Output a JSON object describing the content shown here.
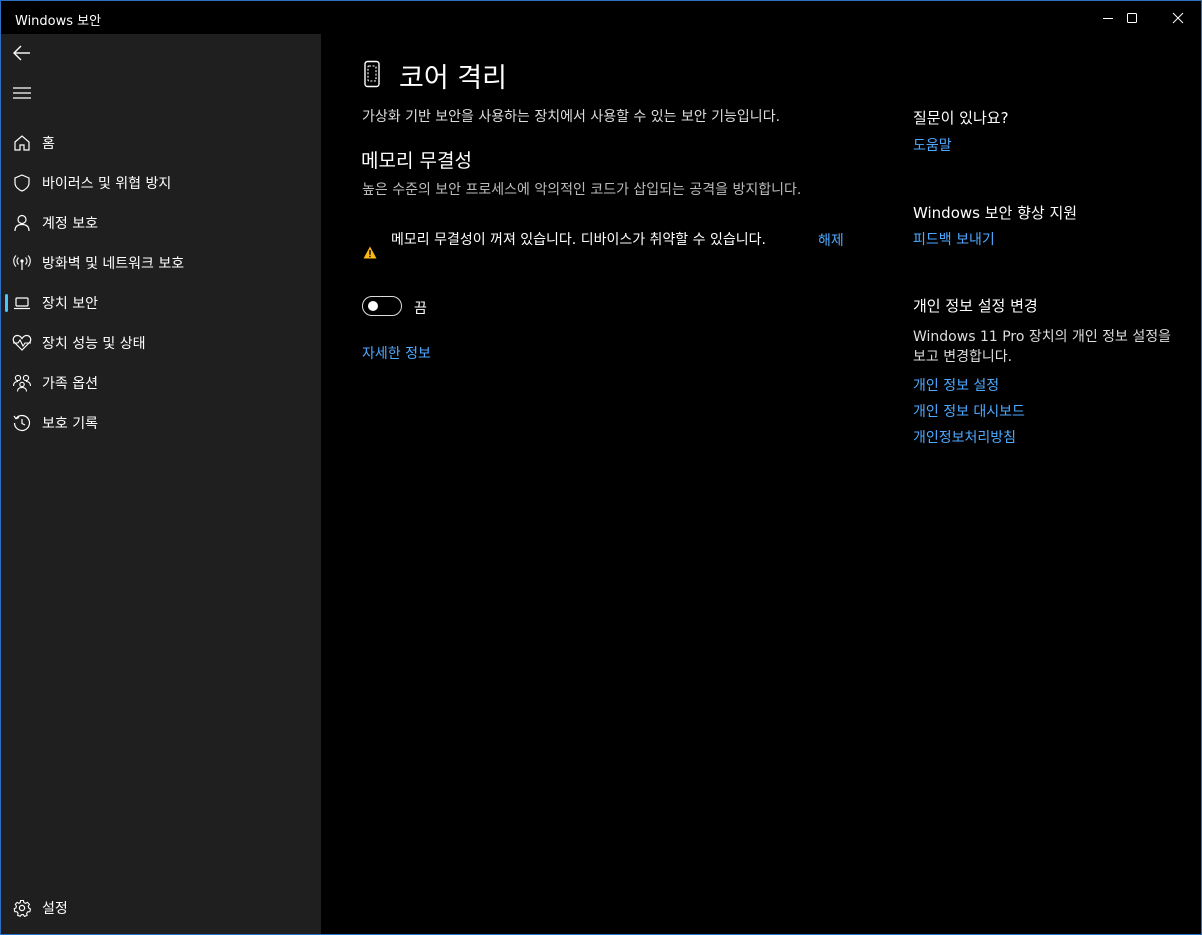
{
  "window": {
    "title": "Windows 보안",
    "minimize_icon": "minimize-icon",
    "maximize_icon": "maximize-icon",
    "close_icon": "close-icon"
  },
  "sidebar": {
    "back_icon": "back-arrow-icon",
    "menu_icon": "hamburger-menu-icon",
    "accent_color": "#4cc2ff",
    "items": [
      {
        "label": "홈",
        "icon": "home-icon"
      },
      {
        "label": "바이러스 및 위협 방지",
        "icon": "shield-icon"
      },
      {
        "label": "계정 보호",
        "icon": "person-icon"
      },
      {
        "label": "방화벽 및 네트워크 보호",
        "icon": "antenna-icon"
      },
      {
        "label": "장치 보안",
        "icon": "laptop-icon",
        "selected": true
      },
      {
        "label": "장치 성능 및 상태",
        "icon": "heart-pulse-icon"
      },
      {
        "label": "가족 옵션",
        "icon": "family-icon"
      },
      {
        "label": "보호 기록",
        "icon": "history-icon"
      }
    ],
    "settings": {
      "label": "설정",
      "icon": "gear-icon"
    }
  },
  "main": {
    "title": "코어 격리",
    "title_icon": "core-isolation-icon",
    "description": "가상화 기반 보안을 사용하는 장치에서 사용할 수 있는 보안 기능입니다.",
    "section": {
      "title": "메모리 무결성",
      "description": "높은 수준의 보안 프로세스에 악의적인 코드가 삽입되는 공격을 방지합니다.",
      "warning": {
        "icon": "warning-icon",
        "color": "#fcb814",
        "text": "메모리 무결성이 꺼져 있습니다. 디바이스가 취약할 수 있습니다.",
        "dismiss_label": "해제"
      },
      "toggle": {
        "state": "off",
        "label": "끔"
      },
      "more_info_label": "자세한 정보"
    }
  },
  "right_column": {
    "question": {
      "heading": "질문이 있나요?",
      "link": "도움말"
    },
    "improve": {
      "heading": "Windows 보안 향상 지원",
      "link": "피드백 보내기"
    },
    "privacy": {
      "heading": "개인 정보 설정 변경",
      "text": "Windows 11 Pro 장치의 개인 정보 설정을 보고 변경합니다.",
      "links": [
        "개인 정보 설정",
        "개인 정보 대시보드",
        "개인정보처리방침"
      ]
    }
  },
  "colors": {
    "link": "#4ea9ff",
    "sidebar_bg": "#1f1f1f",
    "main_bg": "#000000"
  }
}
